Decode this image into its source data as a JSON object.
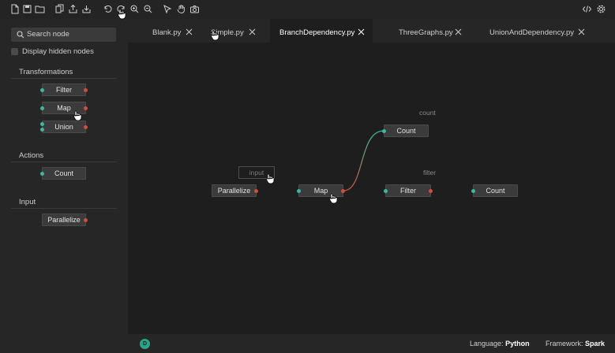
{
  "sidebar": {
    "search_placeholder": "Search node",
    "hidden_nodes_label": "Display hidden nodes",
    "sections": {
      "transformations": {
        "title": "Transformations",
        "nodes": [
          "Filter",
          "Map",
          "Union"
        ]
      },
      "actions": {
        "title": "Actions",
        "nodes": [
          "Count"
        ]
      },
      "input": {
        "title": "Input",
        "nodes": [
          "Parallelize"
        ]
      }
    }
  },
  "tabs": [
    {
      "label": "Blank.py"
    },
    {
      "label": "Simple.py"
    },
    {
      "label": "BranchDependency.py",
      "active": true
    },
    {
      "label": "ThreeGraphs.py"
    },
    {
      "label": "UnionAndDependency.py"
    }
  ],
  "graph": {
    "nodes": {
      "parallelize": "Parallelize",
      "map": "Map",
      "filter": "Filter",
      "count_top": "Count",
      "count_right": "Count"
    },
    "edge_labels": {
      "count": "count",
      "filter": "filter"
    },
    "input_placeholder": "input"
  },
  "status": {
    "avatar_letter": "D",
    "language_label": "Language:",
    "language_value": "Python",
    "framework_label": "Framework:",
    "framework_value": "Spark"
  },
  "colors": {
    "input_port": "#3cb8a0",
    "output_port": "#c8503c",
    "accent": "#2aa58a"
  }
}
